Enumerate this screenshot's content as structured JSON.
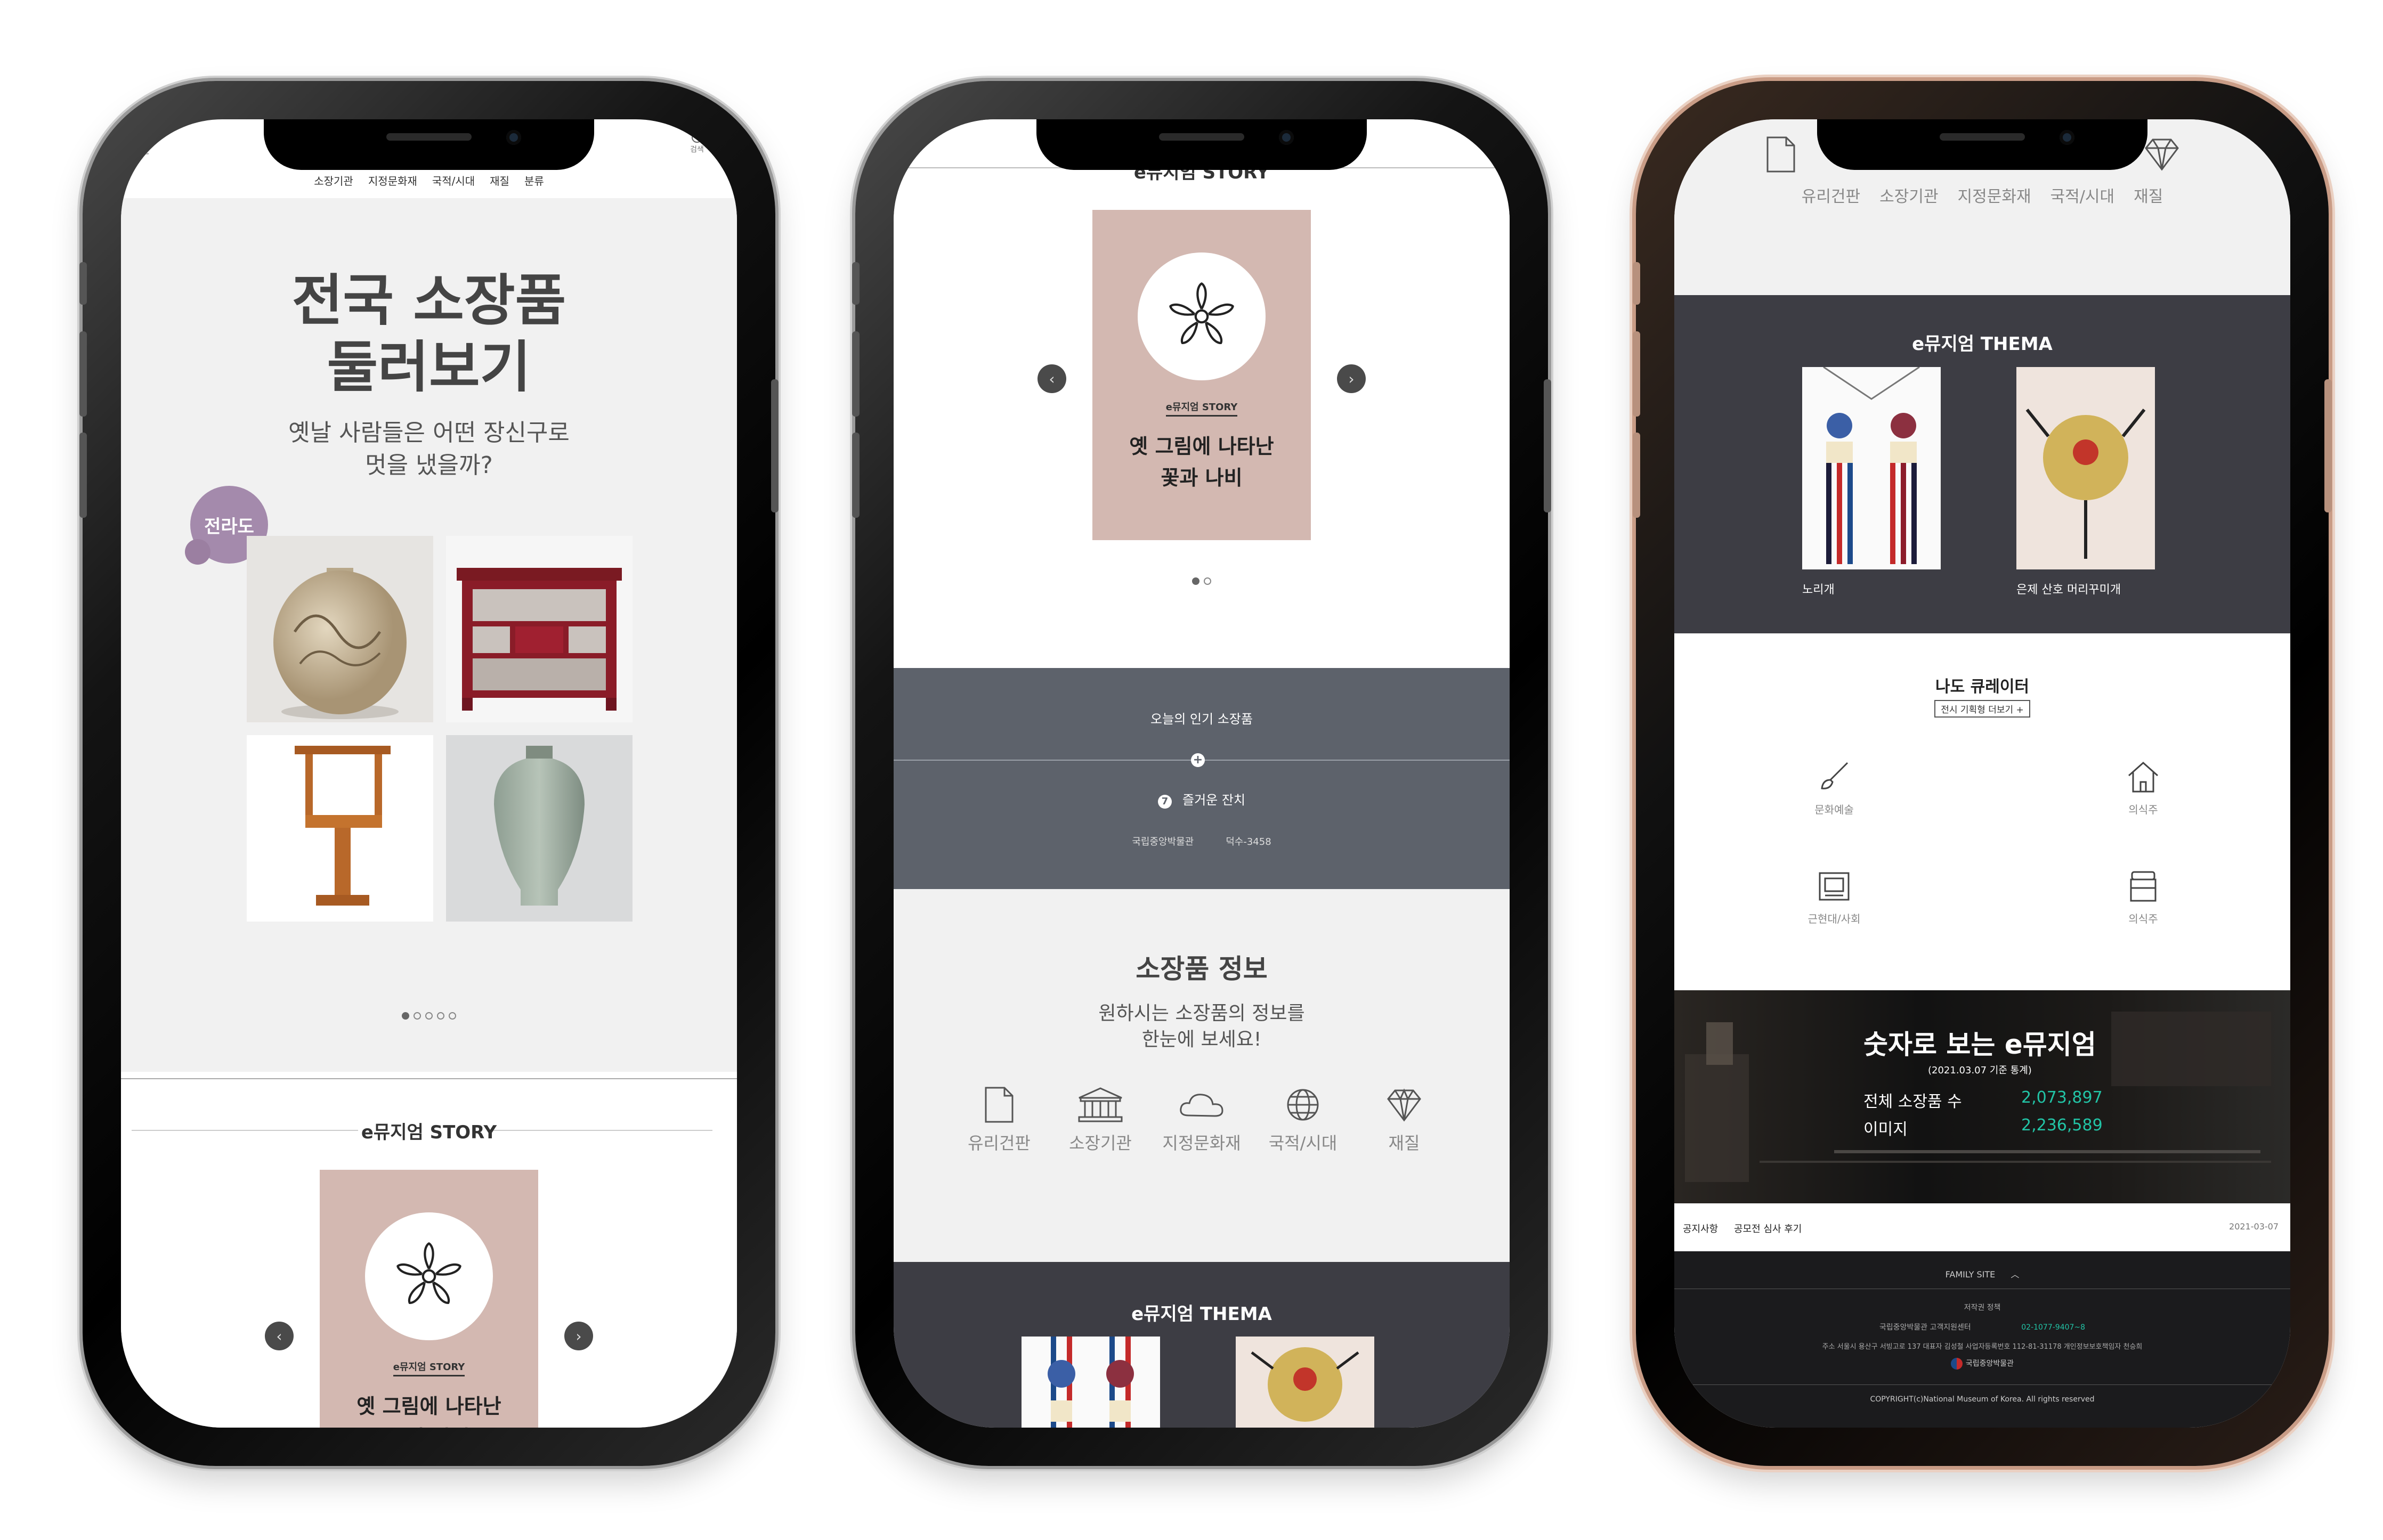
{
  "colors": {
    "story_card": "#d3b8b1",
    "dark_section": "#3d3d44",
    "slate_section": "#5d626b",
    "region_badge": "#a48aac",
    "stat_accent": "#22c4a6"
  },
  "phone1": {
    "search_label": "검색",
    "nav": [
      "소장기관",
      "지정문화재",
      "국적/시대",
      "재질",
      "분류"
    ],
    "hero_title_1": "전국 소장품",
    "hero_title_2": "둘러보기",
    "hero_sub_1": "옛날 사람들은 어떤 장신구로",
    "hero_sub_2": "멋을 냈을까?",
    "region_badge": "전라도",
    "story_heading": "e뮤지엄 STORY",
    "story_tag": "e뮤지엄 STORY",
    "story_title_1": "옛 그림에 나타난",
    "story_title_2": "꽃과 나비",
    "prev_icon": "‹",
    "next_icon": "›"
  },
  "phone2": {
    "story_heading": "e뮤지엄 STORY",
    "story_tag": "e뮤지엄 STORY",
    "story_title_1": "옛 그림에 나타난",
    "story_title_2": "꽃과 나비",
    "popular_title": "오늘의 인기 소장품",
    "popular_rank": "7",
    "popular_item": "즐거운 잔치",
    "popular_museum": "국립중앙박물관",
    "popular_id": "덕수-3458",
    "info_title": "소장품 정보",
    "info_sub_1": "원하시는 소장품의 정보를",
    "info_sub_2": "한눈에 보세요!",
    "icons": [
      {
        "label": "유리건판",
        "icon": "document-icon"
      },
      {
        "label": "소장기관",
        "icon": "museum-icon"
      },
      {
        "label": "지정문화재",
        "icon": "cloud-icon"
      },
      {
        "label": "국적/시대",
        "icon": "globe-icon"
      },
      {
        "label": "재질",
        "icon": "diamond-icon"
      }
    ],
    "thema_title": "e뮤지엄 THEMA",
    "prev_icon": "‹",
    "next_icon": "›"
  },
  "phone3": {
    "icons": [
      "유리건판",
      "소장기관",
      "지정문화재",
      "국적/시대",
      "재질"
    ],
    "thema_title": "e뮤지엄 THEMA",
    "thema_items": [
      "노리개",
      "은제 산호 머리꾸미개"
    ],
    "curator_title": "나도 큐레이터",
    "curator_button": "전시 기획형 더보기 +",
    "categories": [
      "문화예술",
      "의식주",
      "근현대/사회",
      "의식주"
    ],
    "stats_title": "숫자로 보는 e뮤지엄",
    "stats_date": "(2021.03.07 기준 통계)",
    "stats": [
      {
        "label": "전체 소장품 수",
        "value": "2,073,897"
      },
      {
        "label": "이미지",
        "value": "2,236,589"
      }
    ],
    "notice_label": "공지사항",
    "notice_text": "공모전 심사 후기",
    "notice_date": "2021-03-07",
    "family_site": "FAMILY SITE",
    "policy": "저작권 정책",
    "center": "국립중앙박물관 고객지원센터",
    "phone_number": "02-1077-9407~8",
    "address": "주소  서울시 용산구 서빙고로 137   대표자  김성철   사업자등록번호  112-81-31178   개인정보보호책임자  천승희",
    "logo_text": "국립중앙박물관",
    "copyright": "COPYRIGHT(c)National Museum of Korea. All rights reserved"
  }
}
